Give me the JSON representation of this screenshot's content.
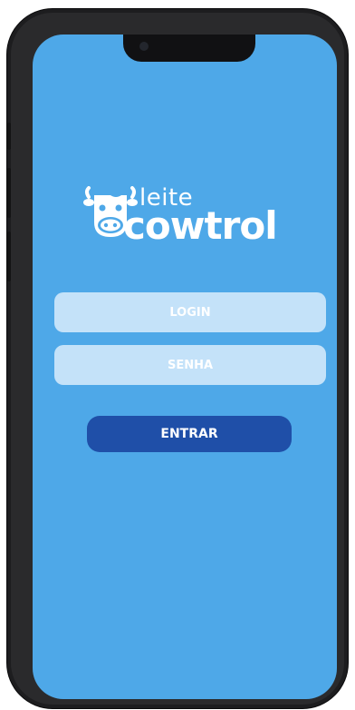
{
  "logo": {
    "top_text": "leite",
    "bottom_text": "cowtrol",
    "icon": "cow-icon"
  },
  "form": {
    "login_placeholder": "LOGIN",
    "senha_placeholder": "SENHA",
    "login_value": "",
    "senha_value": "",
    "submit_label": "ENTRAR"
  },
  "colors": {
    "screen_bg": "#4ea8e8",
    "field_bg": "#c4e2f9",
    "button_bg": "#1f4fa8",
    "frame": "#1d1d1f"
  }
}
